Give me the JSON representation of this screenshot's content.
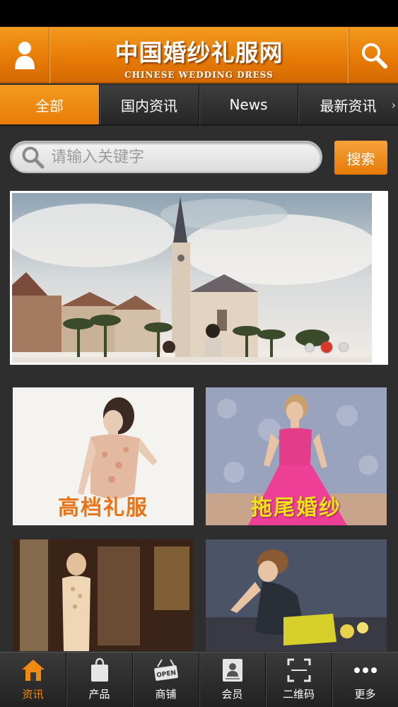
{
  "header": {
    "title_cn": "中国婚纱礼服网",
    "title_en": "CHINESE WEDDING DRESS",
    "left_icon": "user-icon",
    "right_icon": "search-icon"
  },
  "tabs": [
    {
      "label": "全部",
      "active": true
    },
    {
      "label": "国内资讯",
      "active": false
    },
    {
      "label": "News",
      "active": false
    },
    {
      "label": "最新资讯",
      "active": false
    }
  ],
  "search": {
    "placeholder": "请输入关键字",
    "button_label": "搜索"
  },
  "banner": {
    "slide_count": 3,
    "active_slide": 2
  },
  "cards": [
    {
      "label": "高档礼服",
      "label_color": "#e8741a"
    },
    {
      "label": "拖尾婚纱",
      "label_color": "#f2e21a"
    },
    {
      "label": ""
    },
    {
      "label": ""
    }
  ],
  "bottom_nav": [
    {
      "label": "资讯",
      "icon": "home-icon",
      "active": true
    },
    {
      "label": "产品",
      "icon": "shopping-bag-icon",
      "active": false
    },
    {
      "label": "商铺",
      "icon": "open-sign-icon",
      "active": false
    },
    {
      "label": "会员",
      "icon": "member-card-icon",
      "active": false
    },
    {
      "label": "二维码",
      "icon": "qr-scan-icon",
      "active": false
    },
    {
      "label": "更多",
      "icon": "more-dots-icon",
      "active": false
    }
  ],
  "colors": {
    "accent": "#e87d06",
    "dark_bg": "#2e2e2e"
  },
  "nav_icon_text": {
    "open_sign": "OPEN"
  }
}
